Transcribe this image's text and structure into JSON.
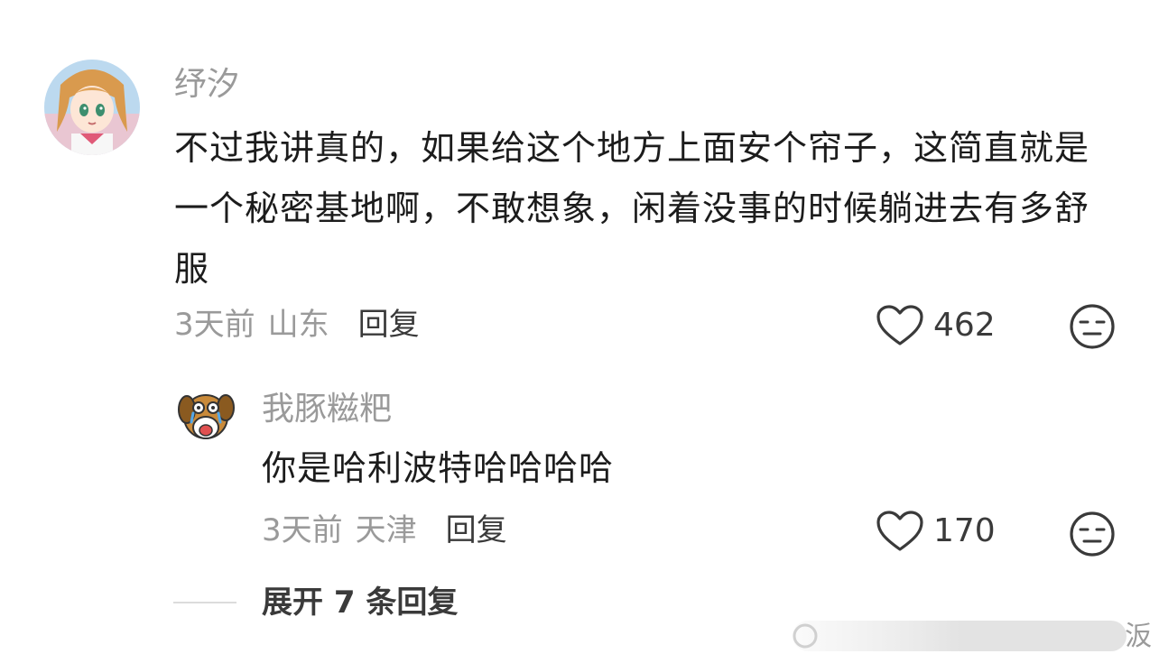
{
  "comment": {
    "username": "纾汐",
    "text": "不过我讲真的，如果给这个地方上面安个帘子，这简直就是一个秘密基地啊，不敢想象，闲着没事的时候躺进去有多舒服",
    "time": "3天前",
    "location": "山东",
    "reply_label": "回复",
    "likes": "462",
    "avatar_icon": "anime-girl-avatar"
  },
  "reply": {
    "username": "我豚糍粑",
    "text": "你是哈利波特哈哈哈哈",
    "time": "3天前",
    "location": "天津",
    "reply_label": "回复",
    "likes": "170",
    "avatar_icon": "crying-dog-avatar"
  },
  "expand": {
    "label": "展开 7 条回复"
  },
  "watermark": {
    "text": "汳"
  },
  "colors": {
    "text_primary": "#1c1c1c",
    "text_secondary": "#9a9a9a",
    "icon": "#3a3a3a"
  }
}
